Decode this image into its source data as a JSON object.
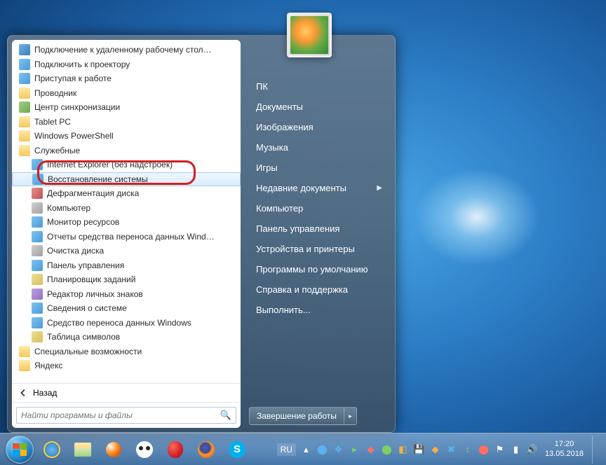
{
  "start_menu": {
    "programs": [
      {
        "label": "Подключение к удаленному рабочему стол…",
        "icon": "app",
        "indent": false
      },
      {
        "label": "Подключить к проектору",
        "icon": "blue",
        "indent": false
      },
      {
        "label": "Приступая к работе",
        "icon": "blue",
        "indent": false
      },
      {
        "label": "Проводник",
        "icon": "folder",
        "indent": false
      },
      {
        "label": "Центр синхронизации",
        "icon": "green",
        "indent": false
      },
      {
        "label": "Tablet PC",
        "icon": "folder",
        "indent": false
      },
      {
        "label": "Windows PowerShell",
        "icon": "folder",
        "indent": false
      },
      {
        "label": "Служебные",
        "icon": "folder",
        "indent": false
      },
      {
        "label": "Internet Explorer (без надстроек)",
        "icon": "blue",
        "indent": true
      },
      {
        "label": "Восстановление системы",
        "icon": "blue",
        "indent": true,
        "selected": true
      },
      {
        "label": "Дефрагментация диска",
        "icon": "red",
        "indent": true
      },
      {
        "label": "Компьютер",
        "icon": "gray",
        "indent": true
      },
      {
        "label": "Монитор ресурсов",
        "icon": "blue",
        "indent": true
      },
      {
        "label": "Отчеты средства переноса данных Wind…",
        "icon": "blue",
        "indent": true
      },
      {
        "label": "Очистка диска",
        "icon": "gray",
        "indent": true
      },
      {
        "label": "Панель управления",
        "icon": "blue",
        "indent": true
      },
      {
        "label": "Планировщик заданий",
        "icon": "yellow",
        "indent": true
      },
      {
        "label": "Редактор личных знаков",
        "icon": "purple",
        "indent": true
      },
      {
        "label": "Сведения о системе",
        "icon": "blue",
        "indent": true
      },
      {
        "label": "Средство переноса данных Windows",
        "icon": "blue",
        "indent": true
      },
      {
        "label": "Таблица символов",
        "icon": "yellow",
        "indent": true
      },
      {
        "label": "Специальные возможности",
        "icon": "folder",
        "indent": false
      },
      {
        "label": "Яндекс",
        "icon": "folder",
        "indent": false
      }
    ],
    "back_label": "Назад",
    "search_placeholder": "Найти программы и файлы",
    "right_items": [
      {
        "label": "ПК",
        "arrow": false
      },
      {
        "label": "Документы",
        "arrow": false
      },
      {
        "label": "Изображения",
        "arrow": false
      },
      {
        "label": "Музыка",
        "arrow": false
      },
      {
        "label": "Игры",
        "arrow": false
      },
      {
        "label": "Недавние документы",
        "arrow": true
      },
      {
        "label": "Компьютер",
        "arrow": false
      },
      {
        "label": "Панель управления",
        "arrow": false
      },
      {
        "label": "Устройства и принтеры",
        "arrow": false
      },
      {
        "label": "Программы по умолчанию",
        "arrow": false
      },
      {
        "label": "Справка и поддержка",
        "arrow": false
      },
      {
        "label": "Выполнить...",
        "arrow": false
      }
    ],
    "shutdown_label": "Завершение работы"
  },
  "taskbar": {
    "lang": "RU",
    "time": "17:20",
    "date": "13.05.2018"
  }
}
